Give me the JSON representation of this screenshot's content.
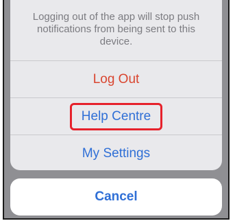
{
  "action_sheet": {
    "message": "Logging out of the app will stop push notifications from being sent to this device.",
    "actions": [
      {
        "label": "Log Out",
        "style": "destructive",
        "color": "#d9452f"
      },
      {
        "label": "Help Centre",
        "style": "default",
        "color": "#2f6fd6",
        "highlighted": true
      },
      {
        "label": "My Settings",
        "style": "default",
        "color": "#2f6fd6"
      }
    ],
    "cancel_label": "Cancel"
  },
  "colors": {
    "overlay": "#8f8f93",
    "sheet_background": "#e9e9ec",
    "highlight_border": "#e6212b"
  }
}
